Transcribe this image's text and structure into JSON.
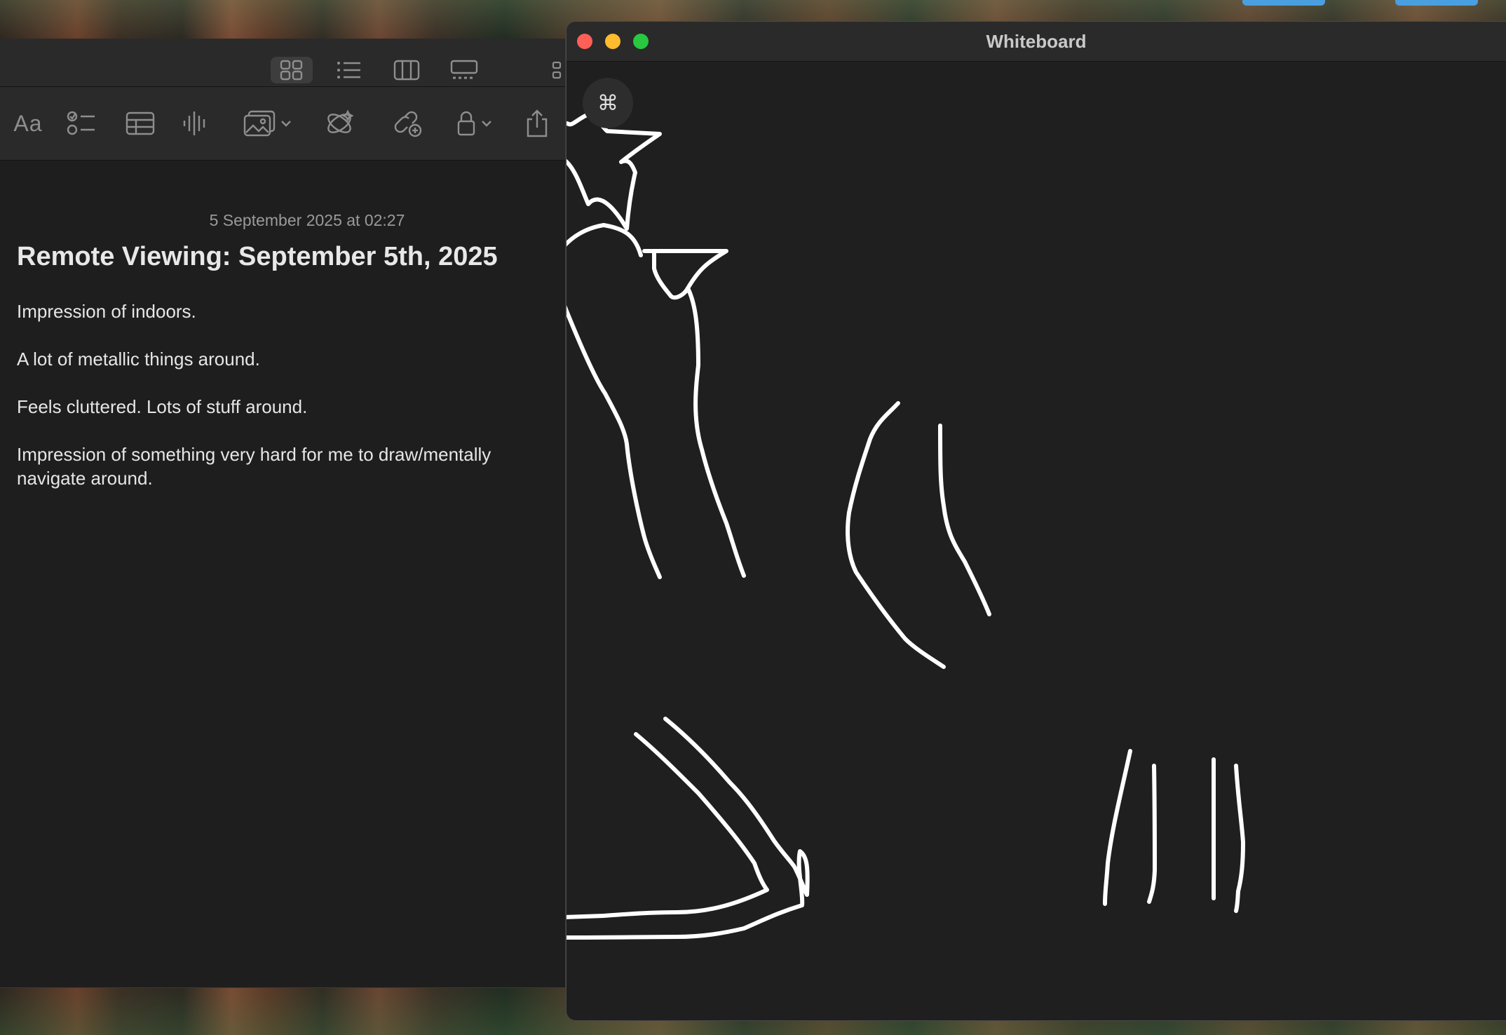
{
  "whiteboard": {
    "title": "Whiteboard",
    "shortcut_button_glyph": "⌘"
  },
  "notes": {
    "toolbar": {
      "format_label": "Aa"
    },
    "note": {
      "timestamp": "5 September 2025 at 02:27",
      "title": "Remote Viewing: September 5th, 2025",
      "paragraphs": [
        "Impression of indoors.",
        "A lot of metallic things around.",
        "Feels cluttered. Lots of stuff around.",
        "Impression of something very hard for me to draw/mentally navigate around."
      ]
    }
  },
  "colors": {
    "notes_background": "#1e1e1e",
    "whiteboard_background": "#1f1f1f",
    "stroke": "#ffffff",
    "close": "#fe5f57",
    "minimize": "#febc2e",
    "zoom": "#28c840"
  }
}
